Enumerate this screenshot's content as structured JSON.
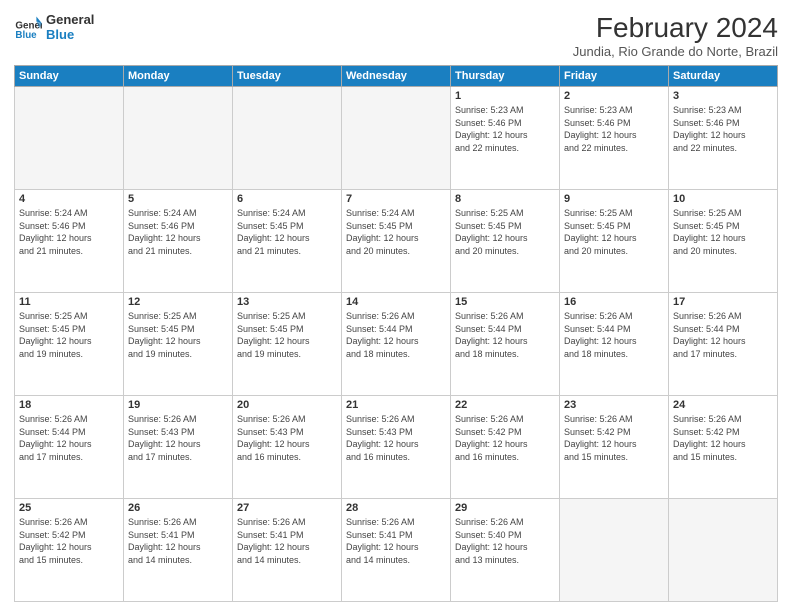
{
  "logo": {
    "line1": "General",
    "line2": "Blue"
  },
  "title": "February 2024",
  "subtitle": "Jundia, Rio Grande do Norte, Brazil",
  "days_of_week": [
    "Sunday",
    "Monday",
    "Tuesday",
    "Wednesday",
    "Thursday",
    "Friday",
    "Saturday"
  ],
  "weeks": [
    [
      {
        "day": "",
        "info": ""
      },
      {
        "day": "",
        "info": ""
      },
      {
        "day": "",
        "info": ""
      },
      {
        "day": "",
        "info": ""
      },
      {
        "day": "1",
        "info": "Sunrise: 5:23 AM\nSunset: 5:46 PM\nDaylight: 12 hours\nand 22 minutes."
      },
      {
        "day": "2",
        "info": "Sunrise: 5:23 AM\nSunset: 5:46 PM\nDaylight: 12 hours\nand 22 minutes."
      },
      {
        "day": "3",
        "info": "Sunrise: 5:23 AM\nSunset: 5:46 PM\nDaylight: 12 hours\nand 22 minutes."
      }
    ],
    [
      {
        "day": "4",
        "info": "Sunrise: 5:24 AM\nSunset: 5:46 PM\nDaylight: 12 hours\nand 21 minutes."
      },
      {
        "day": "5",
        "info": "Sunrise: 5:24 AM\nSunset: 5:46 PM\nDaylight: 12 hours\nand 21 minutes."
      },
      {
        "day": "6",
        "info": "Sunrise: 5:24 AM\nSunset: 5:45 PM\nDaylight: 12 hours\nand 21 minutes."
      },
      {
        "day": "7",
        "info": "Sunrise: 5:24 AM\nSunset: 5:45 PM\nDaylight: 12 hours\nand 20 minutes."
      },
      {
        "day": "8",
        "info": "Sunrise: 5:25 AM\nSunset: 5:45 PM\nDaylight: 12 hours\nand 20 minutes."
      },
      {
        "day": "9",
        "info": "Sunrise: 5:25 AM\nSunset: 5:45 PM\nDaylight: 12 hours\nand 20 minutes."
      },
      {
        "day": "10",
        "info": "Sunrise: 5:25 AM\nSunset: 5:45 PM\nDaylight: 12 hours\nand 20 minutes."
      }
    ],
    [
      {
        "day": "11",
        "info": "Sunrise: 5:25 AM\nSunset: 5:45 PM\nDaylight: 12 hours\nand 19 minutes."
      },
      {
        "day": "12",
        "info": "Sunrise: 5:25 AM\nSunset: 5:45 PM\nDaylight: 12 hours\nand 19 minutes."
      },
      {
        "day": "13",
        "info": "Sunrise: 5:25 AM\nSunset: 5:45 PM\nDaylight: 12 hours\nand 19 minutes."
      },
      {
        "day": "14",
        "info": "Sunrise: 5:26 AM\nSunset: 5:44 PM\nDaylight: 12 hours\nand 18 minutes."
      },
      {
        "day": "15",
        "info": "Sunrise: 5:26 AM\nSunset: 5:44 PM\nDaylight: 12 hours\nand 18 minutes."
      },
      {
        "day": "16",
        "info": "Sunrise: 5:26 AM\nSunset: 5:44 PM\nDaylight: 12 hours\nand 18 minutes."
      },
      {
        "day": "17",
        "info": "Sunrise: 5:26 AM\nSunset: 5:44 PM\nDaylight: 12 hours\nand 17 minutes."
      }
    ],
    [
      {
        "day": "18",
        "info": "Sunrise: 5:26 AM\nSunset: 5:44 PM\nDaylight: 12 hours\nand 17 minutes."
      },
      {
        "day": "19",
        "info": "Sunrise: 5:26 AM\nSunset: 5:43 PM\nDaylight: 12 hours\nand 17 minutes."
      },
      {
        "day": "20",
        "info": "Sunrise: 5:26 AM\nSunset: 5:43 PM\nDaylight: 12 hours\nand 16 minutes."
      },
      {
        "day": "21",
        "info": "Sunrise: 5:26 AM\nSunset: 5:43 PM\nDaylight: 12 hours\nand 16 minutes."
      },
      {
        "day": "22",
        "info": "Sunrise: 5:26 AM\nSunset: 5:42 PM\nDaylight: 12 hours\nand 16 minutes."
      },
      {
        "day": "23",
        "info": "Sunrise: 5:26 AM\nSunset: 5:42 PM\nDaylight: 12 hours\nand 15 minutes."
      },
      {
        "day": "24",
        "info": "Sunrise: 5:26 AM\nSunset: 5:42 PM\nDaylight: 12 hours\nand 15 minutes."
      }
    ],
    [
      {
        "day": "25",
        "info": "Sunrise: 5:26 AM\nSunset: 5:42 PM\nDaylight: 12 hours\nand 15 minutes."
      },
      {
        "day": "26",
        "info": "Sunrise: 5:26 AM\nSunset: 5:41 PM\nDaylight: 12 hours\nand 14 minutes."
      },
      {
        "day": "27",
        "info": "Sunrise: 5:26 AM\nSunset: 5:41 PM\nDaylight: 12 hours\nand 14 minutes."
      },
      {
        "day": "28",
        "info": "Sunrise: 5:26 AM\nSunset: 5:41 PM\nDaylight: 12 hours\nand 14 minutes."
      },
      {
        "day": "29",
        "info": "Sunrise: 5:26 AM\nSunset: 5:40 PM\nDaylight: 12 hours\nand 13 minutes."
      },
      {
        "day": "",
        "info": ""
      },
      {
        "day": "",
        "info": ""
      }
    ]
  ]
}
